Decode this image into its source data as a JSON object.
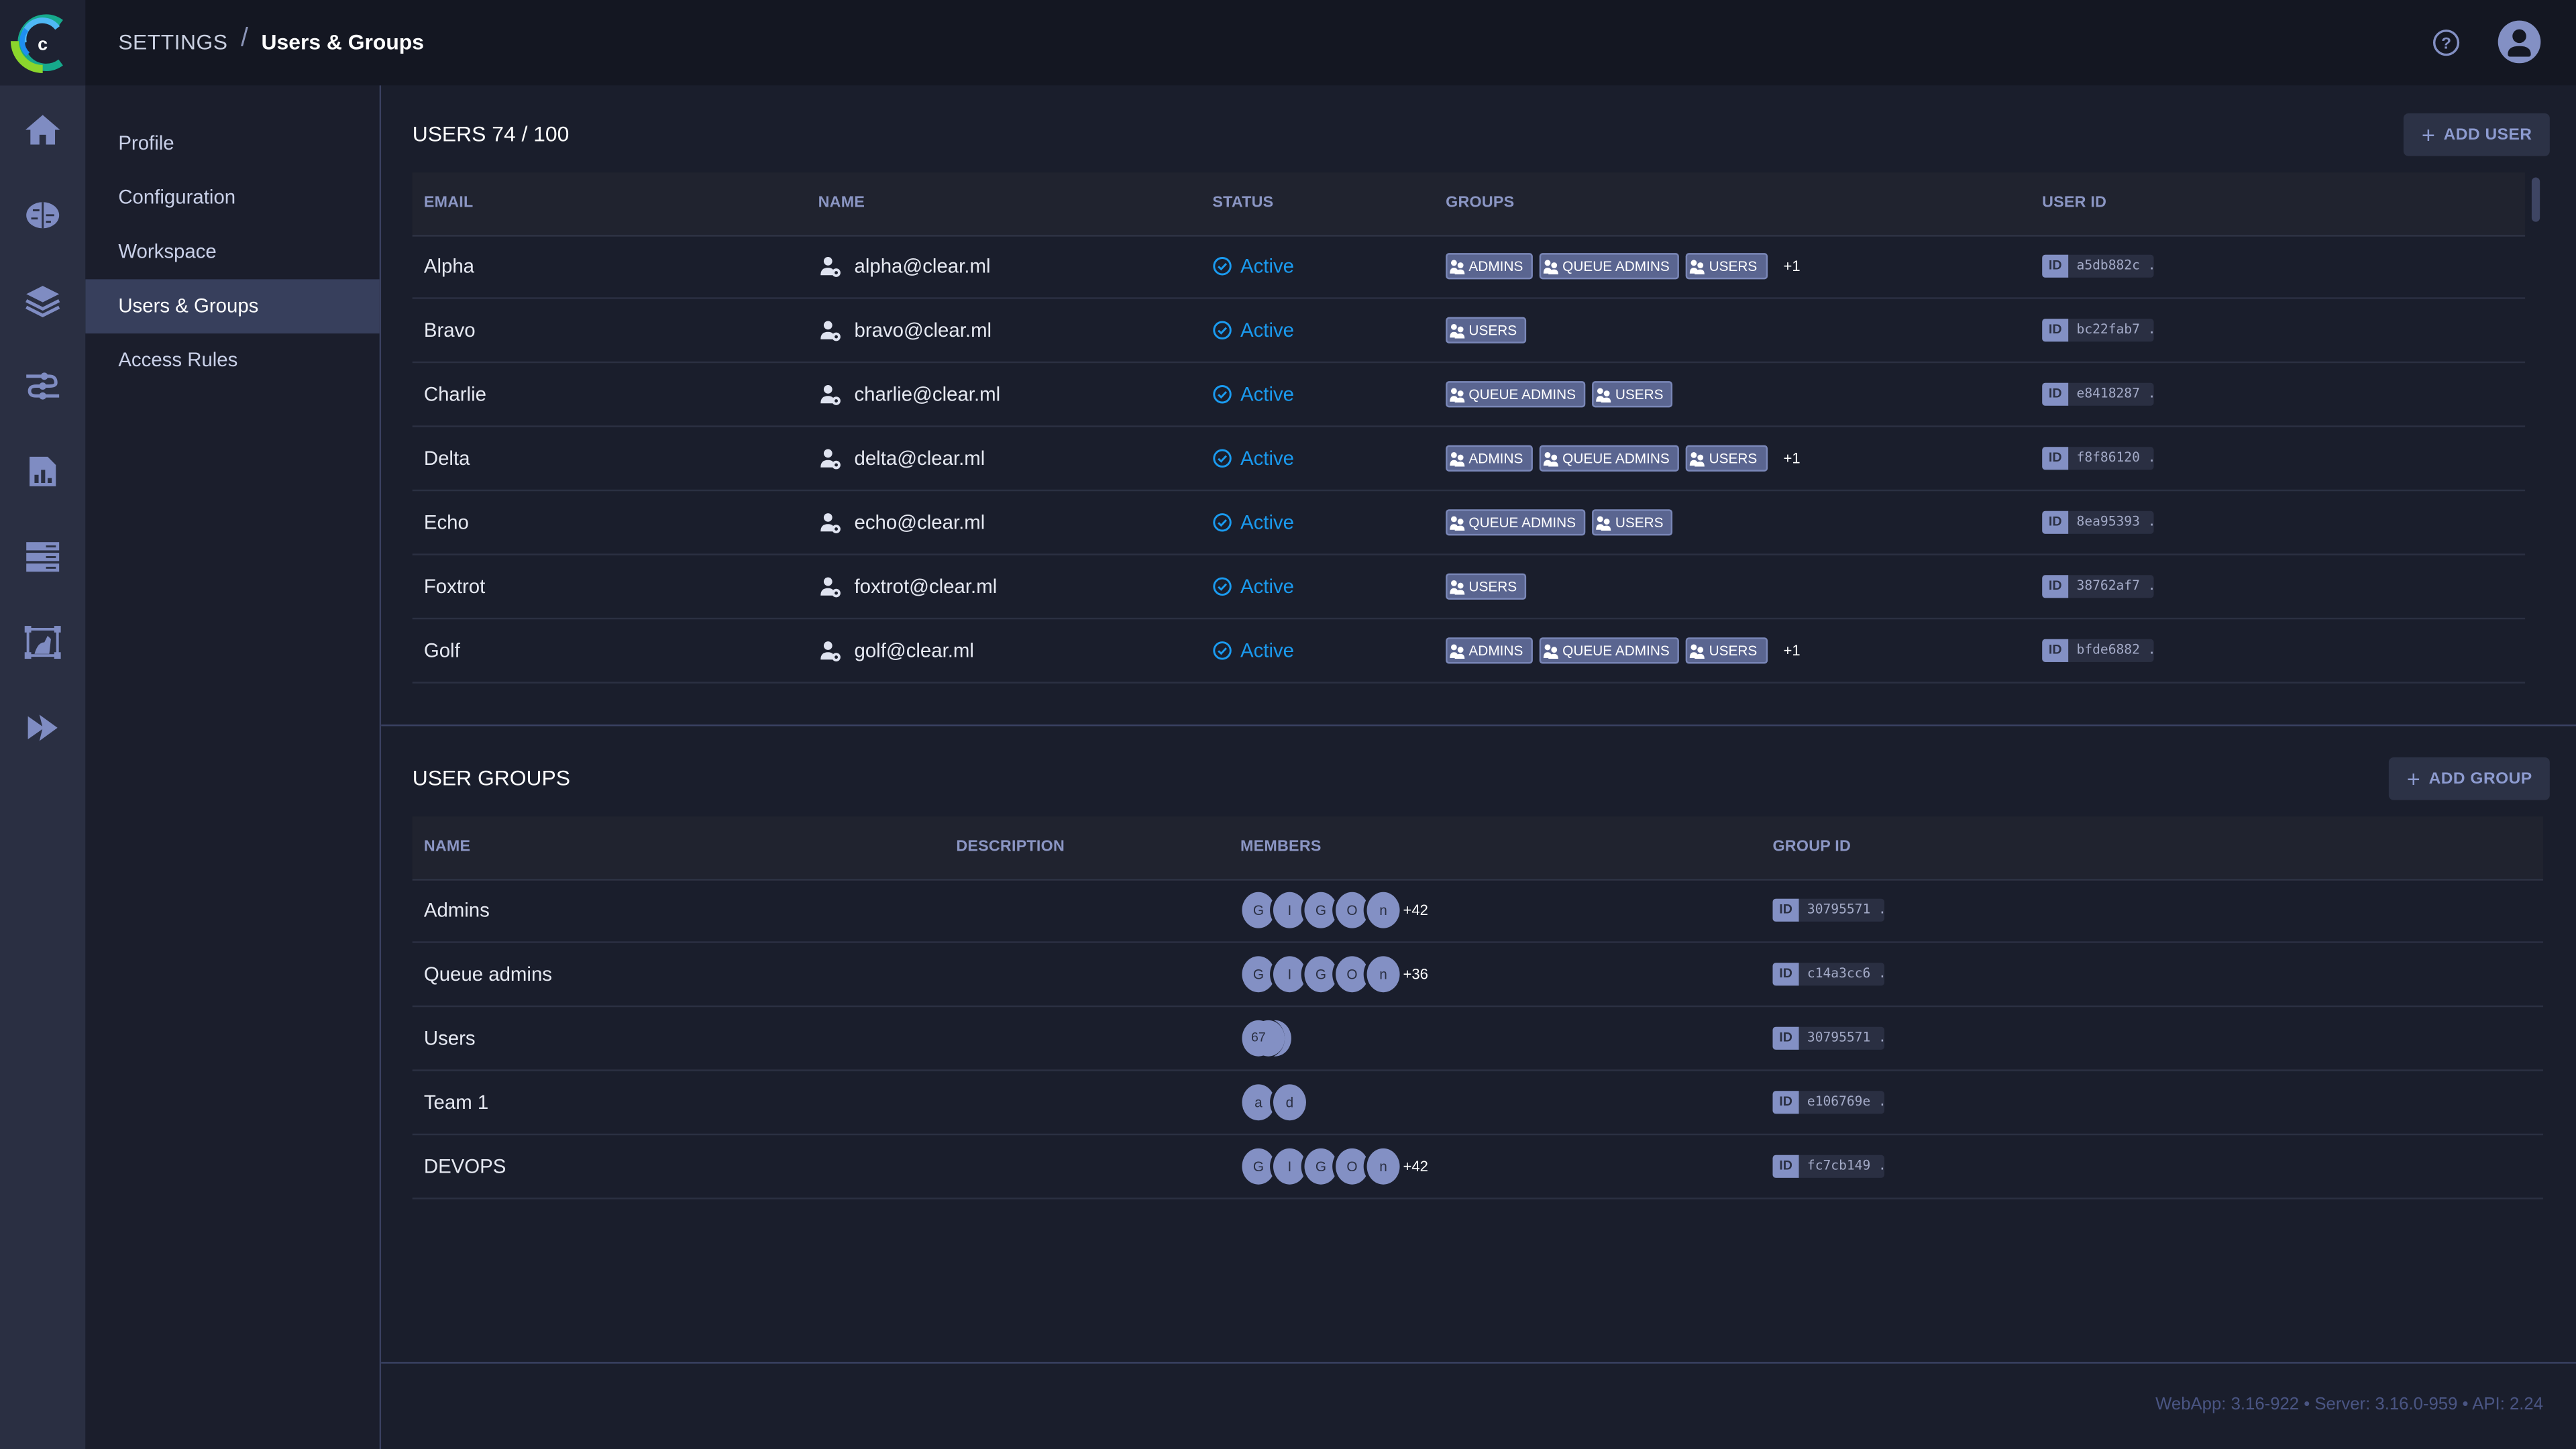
{
  "app": {
    "logo": "clearml-logo",
    "breadcrumb": {
      "root": "SETTINGS",
      "separator": "/",
      "current": "Users & Groups"
    },
    "header_icons": {
      "help": "help-circle-icon",
      "user": "user-avatar-icon"
    }
  },
  "rail": {
    "items": [
      {
        "icon": "home-icon",
        "label": "Home"
      },
      {
        "icon": "brain-icon",
        "label": "Projects"
      },
      {
        "icon": "layers-icon",
        "label": "Datasets"
      },
      {
        "icon": "pipelines-icon",
        "label": "Pipelines"
      },
      {
        "icon": "reports-icon",
        "label": "Reports"
      },
      {
        "icon": "workers-queues-icon",
        "label": "Workers & Queues"
      },
      {
        "icon": "hyper-datasets-icon",
        "label": "Hyper-Datasets"
      },
      {
        "icon": "applications-icon",
        "label": "Applications"
      }
    ]
  },
  "settings_nav": {
    "items": [
      {
        "label": "Profile",
        "active": false
      },
      {
        "label": "Configuration",
        "active": false
      },
      {
        "label": "Workspace",
        "active": false
      },
      {
        "label": "Users & Groups",
        "active": true
      },
      {
        "label": "Access Rules",
        "active": false
      }
    ]
  },
  "users": {
    "title": "USERS 74 / 100",
    "add_label": "ADD USER",
    "columns": [
      "EMAIL",
      "NAME",
      "STATUS",
      "GROUPS",
      "USER ID"
    ],
    "rows": [
      {
        "name": "Alpha",
        "email": "alpha@clear.ml",
        "status": "Active",
        "groups": [
          "ADMINS",
          "QUEUE ADMINS",
          "USERS"
        ],
        "more": "+1",
        "id": "a5db882c ..."
      },
      {
        "name": "Bravo",
        "email": "bravo@clear.ml",
        "status": "Active",
        "groups": [
          "USERS"
        ],
        "more": "",
        "id": "bc22fab7 ..."
      },
      {
        "name": "Charlie",
        "email": "charlie@clear.ml",
        "status": "Active",
        "groups": [
          "QUEUE ADMINS",
          "USERS"
        ],
        "more": "",
        "id": "e8418287 ..."
      },
      {
        "name": "Delta",
        "email": "delta@clear.ml",
        "status": "Active",
        "groups": [
          "ADMINS",
          "QUEUE ADMINS",
          "USERS"
        ],
        "more": "+1",
        "id": "f8f86120 ..."
      },
      {
        "name": "Echo",
        "email": "echo@clear.ml",
        "status": "Active",
        "groups": [
          "QUEUE ADMINS",
          "USERS"
        ],
        "more": "",
        "id": "8ea95393 ..."
      },
      {
        "name": "Foxtrot",
        "email": "foxtrot@clear.ml",
        "status": "Active",
        "groups": [
          "USERS"
        ],
        "more": "",
        "id": "38762af7 ..."
      },
      {
        "name": "Golf",
        "email": "golf@clear.ml",
        "status": "Active",
        "groups": [
          "ADMINS",
          "QUEUE ADMINS",
          "USERS"
        ],
        "more": "+1",
        "id": "bfde6882 ..."
      }
    ]
  },
  "groups": {
    "title": "USER GROUPS",
    "add_label": "ADD GROUP",
    "columns": [
      "NAME",
      "DESCRIPTION",
      "MEMBERS",
      "GROUP ID"
    ],
    "rows": [
      {
        "name": "Admins",
        "description": "",
        "members": [
          "G",
          "I",
          "G",
          "O",
          "n"
        ],
        "more": "+42",
        "stack_count": "",
        "id": "30795571 ..."
      },
      {
        "name": "Queue admins",
        "description": "",
        "members": [
          "G",
          "I",
          "G",
          "O",
          "n"
        ],
        "more": "+36",
        "stack_count": "",
        "id": "c14a3cc6 ..."
      },
      {
        "name": "Users",
        "description": "",
        "members": [],
        "more": "",
        "stack_count": "67",
        "id": "30795571 ..."
      },
      {
        "name": "Team 1",
        "description": "",
        "members": [
          "a",
          "d"
        ],
        "more": "",
        "stack_count": "",
        "id": "e106769e ..."
      },
      {
        "name": "DEVOPS",
        "description": "",
        "members": [
          "G",
          "I",
          "G",
          "O",
          "n"
        ],
        "more": "+42",
        "stack_count": "",
        "id": "fc7cb149 ..."
      }
    ]
  },
  "footer": {
    "version": "WebApp: 3.16-922 • Server: 3.16.0-959 • API: 2.24"
  },
  "colors": {
    "accent": "#8390c4",
    "status_active": "#1a9bf0",
    "active_nav": "#373f5c",
    "background": "#1a1e2c"
  }
}
